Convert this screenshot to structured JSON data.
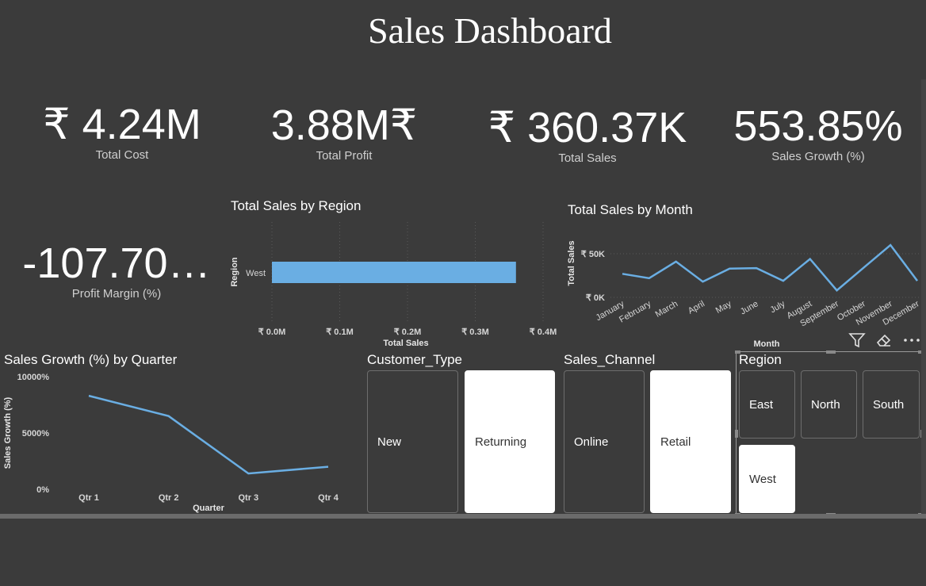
{
  "title": "Sales Dashboard",
  "kpis": [
    {
      "value": "₹ 4.24M",
      "label": "Total Cost"
    },
    {
      "value": "3.88M₹",
      "label": "Total Profit"
    },
    {
      "value": "₹ 360.37K",
      "label": "Total Sales"
    },
    {
      "value": "553.85%",
      "label": "Sales Growth (%)"
    },
    {
      "value": "-107.70…",
      "label": "Profit Margin (%)"
    }
  ],
  "colors": {
    "background": "#3b3b3b",
    "series": "#6aaee3",
    "tile_selected": "#ffffff"
  },
  "region_chart": {
    "title": "Total Sales by Region",
    "chart_data": {
      "type": "bar",
      "orientation": "horizontal",
      "categories": [
        "West"
      ],
      "values": [
        0.36
      ],
      "xticks": [
        "₹ 0.0M",
        "₹ 0.1M",
        "₹ 0.2M",
        "₹ 0.3M",
        "₹ 0.4M"
      ],
      "xlim": [
        0,
        0.4
      ],
      "xlabel": "Total Sales",
      "ylabel": "Region",
      "grid": true
    }
  },
  "month_chart": {
    "title": "Total Sales by Month",
    "chart_data": {
      "type": "line",
      "x": [
        "January",
        "February",
        "March",
        "April",
        "May",
        "June",
        "July",
        "August",
        "September",
        "October",
        "November",
        "December"
      ],
      "values": [
        27000,
        22000,
        41000,
        18000,
        33000,
        33500,
        19000,
        44000,
        8000,
        34000,
        60000,
        19000
      ],
      "yticks": [
        "₹ 0K",
        "₹ 50K"
      ],
      "ylim": [
        0,
        60000
      ],
      "xlabel": "Month",
      "ylabel": "Total Sales",
      "grid": true
    }
  },
  "quarter_chart": {
    "title": "Sales Growth (%) by Quarter",
    "chart_data": {
      "type": "line",
      "x": [
        "Qtr 1",
        "Qtr 2",
        "Qtr 3",
        "Qtr 4"
      ],
      "values": [
        8300,
        6500,
        1400,
        2000
      ],
      "yticks": [
        "0%",
        "5000%",
        "10000%"
      ],
      "ylim": [
        0,
        10000
      ],
      "xlabel": "Quarter",
      "ylabel": "Sales Growth (%)"
    }
  },
  "slicers": {
    "customer_type": {
      "title": "Customer_Type",
      "options": [
        "New",
        "Returning"
      ],
      "selected": "Returning"
    },
    "sales_channel": {
      "title": "Sales_Channel",
      "options": [
        "Online",
        "Retail"
      ],
      "selected": "Retail"
    },
    "region": {
      "title": "Region",
      "options": [
        "East",
        "North",
        "South",
        "West"
      ],
      "selected": "West"
    }
  },
  "toolbar": {
    "icons": [
      "filter-icon",
      "eraser-icon",
      "more-options-icon"
    ]
  }
}
